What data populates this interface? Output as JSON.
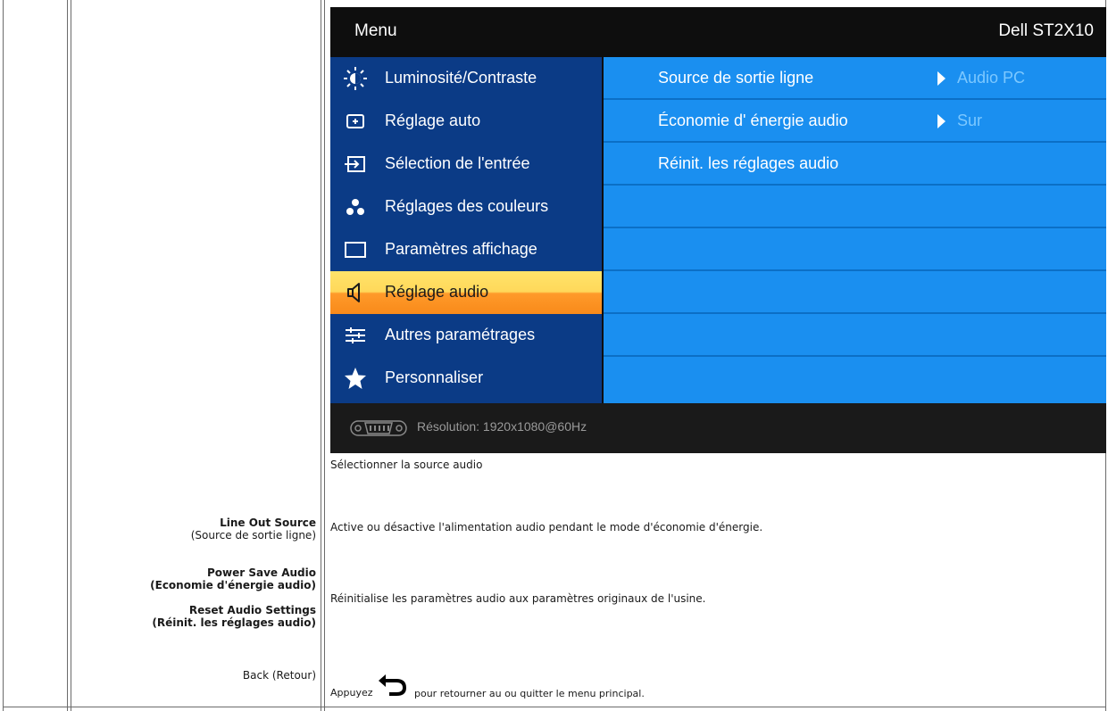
{
  "osd": {
    "title": "Menu",
    "model": "Dell ST2X10",
    "menu_items": [
      {
        "label": "Luminosité/Contraste",
        "icon": "brightness-icon"
      },
      {
        "label": "Réglage auto",
        "icon": "auto-adjust-icon"
      },
      {
        "label": "Sélection de l'entrée",
        "icon": "input-source-icon"
      },
      {
        "label": "Réglages des couleurs",
        "icon": "color-settings-icon"
      },
      {
        "label": "Paramètres affichage",
        "icon": "display-settings-icon"
      },
      {
        "label": "Réglage audio",
        "icon": "speaker-icon",
        "selected": true
      },
      {
        "label": "Autres paramétrages",
        "icon": "other-settings-icon"
      },
      {
        "label": "Personnaliser",
        "icon": "star-icon"
      }
    ],
    "sub_items": [
      {
        "label": "Source de sortie ligne",
        "value": "Audio PC"
      },
      {
        "label": "Économie d'  énergie audio",
        "value": "Sur"
      },
      {
        "label": "Réinit. les réglages audio",
        "value": ""
      }
    ],
    "footer": {
      "resolution": "Résolution:  1920x1080@60Hz",
      "icon": "vga-connector-icon"
    },
    "colors": {
      "menu_bg": "#0b3b86",
      "submenu_bg": "#1a8ff0",
      "selected": "#ffd85a",
      "header_bg": "#0e0e0e"
    }
  },
  "intro": "Sélectionner la source audio",
  "rows": [
    {
      "label": "Line Out Source",
      "sub": "(Source de sortie ligne)",
      "desc": "Active ou désactive l'alimentation audio pendant le mode d'économie d'énergie."
    },
    {
      "label": "Power Save Audio",
      "sub": "(Economie d'énergie audio)",
      "desc": "Réinitialise les paramètres audio aux paramètres originaux de l'usine."
    },
    {
      "label": "Reset Audio Settings",
      "sub": "(Réinit. les réglages audio)",
      "desc": ""
    },
    {
      "label": "Back (Retour)",
      "sub": "",
      "desc_before": "Appuyez",
      "desc_after": "pour retourner au ou quitter le menu principal.",
      "icon": "back-arrow-icon"
    }
  ]
}
